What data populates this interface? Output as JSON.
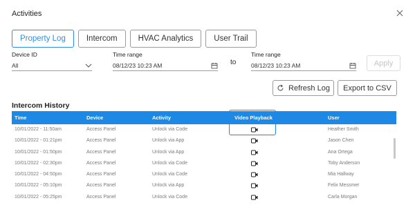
{
  "dialog": {
    "title": "Activities",
    "close_icon": "close-icon"
  },
  "tabs": [
    {
      "label": "Property Log",
      "active": true
    },
    {
      "label": "Intercom",
      "active": false
    },
    {
      "label": "HVAC Analytics",
      "active": false
    },
    {
      "label": "User Trail",
      "active": false
    }
  ],
  "filters": {
    "device_label": "Device ID",
    "device_value": "All",
    "from_label": "Time range",
    "from_value": "08/12/23 10:23 AM",
    "to_text": "to",
    "to_label": "Time range",
    "to_value": "08/12/23 10:23 AM",
    "apply_label": "Apply"
  },
  "actions": {
    "refresh_label": "Refresh Log",
    "export_label": "Export to CSV"
  },
  "history": {
    "title": "Intercom History",
    "columns": [
      "Time",
      "Device",
      "Activity",
      "Video Playback",
      "User"
    ],
    "rows": [
      {
        "time": "10/01/2022 - 11:50am",
        "device": "Access Panel",
        "activity": "Unlock via Code",
        "user": "Heather Smith"
      },
      {
        "time": "10/01/2022 - 01:21pm",
        "device": "Access Panel",
        "activity": "Unlock via App",
        "user": "Jason Chen"
      },
      {
        "time": "10/01/2022 - 01:50pm",
        "device": "Access Panel",
        "activity": "Unlock via App",
        "user": "Ana Ortega"
      },
      {
        "time": "10/01/2022 - 02:30pm",
        "device": "Access Panel",
        "activity": "Unlock via Code",
        "user": "Toby Anderson"
      },
      {
        "time": "10/01/2022 - 04:50pm",
        "device": "Access Panel",
        "activity": "Unlock via Code",
        "user": "Mia Hallway"
      },
      {
        "time": "10/01/2022 - 05:10pm",
        "device": "Access Panel",
        "activity": "Unlock via App",
        "user": "Felix Messmer"
      },
      {
        "time": "10/01/2022 - 05:25pm",
        "device": "Access Panel",
        "activity": "Unlock via Code",
        "user": "Carla Morgan"
      }
    ]
  },
  "colors": {
    "accent": "#1e88e5",
    "tab_active": "#2b8ee8",
    "row_text": "#7a7a7a"
  }
}
